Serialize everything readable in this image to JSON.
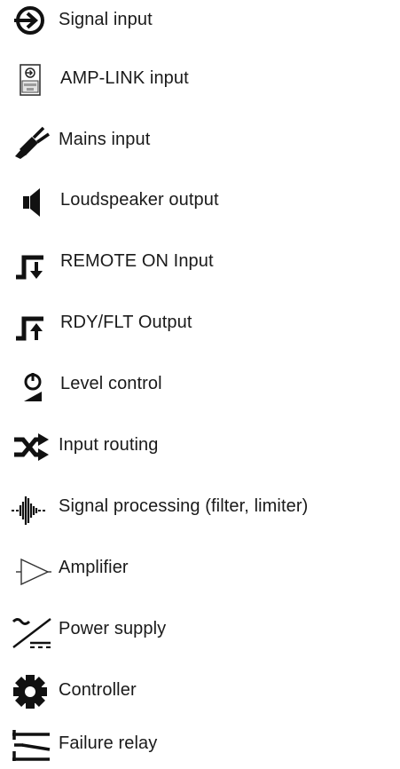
{
  "legend": {
    "items": [
      {
        "icon": "signal-input-icon",
        "label": "Signal input"
      },
      {
        "icon": "amp-link-input-icon",
        "label": "AMP-LINK input"
      },
      {
        "icon": "mains-plug-icon",
        "label": "Mains input"
      },
      {
        "icon": "loudspeaker-icon",
        "label": "Loudspeaker output"
      },
      {
        "icon": "remote-on-input-icon",
        "label": "REMOTE ON Input"
      },
      {
        "icon": "rdy-flt-output-icon",
        "label": "RDY/FLT Output"
      },
      {
        "icon": "level-control-icon",
        "label": "Level control"
      },
      {
        "icon": "input-routing-icon",
        "label": "Input routing"
      },
      {
        "icon": "signal-processing-icon",
        "label": "Signal processing (filter, limiter)"
      },
      {
        "icon": "amplifier-icon",
        "label": "Amplifier"
      },
      {
        "icon": "power-supply-icon",
        "label": "Power supply"
      },
      {
        "icon": "controller-gear-icon",
        "label": "Controller"
      },
      {
        "icon": "failure-relay-icon",
        "label": "Failure relay"
      }
    ]
  }
}
